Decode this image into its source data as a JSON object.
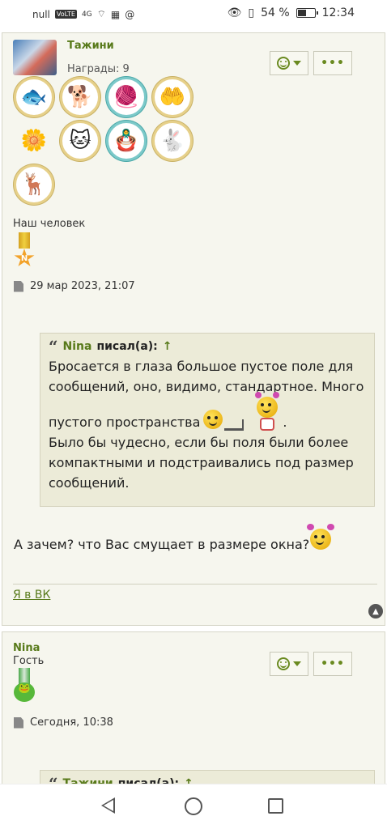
{
  "status_bar": {
    "carrier": "null",
    "network_tag": "VoLTE",
    "signal": "4G",
    "battery_percent_text": "54 %",
    "battery_level": 54,
    "time": "12:34"
  },
  "post1": {
    "username": "Тажини",
    "awards_label": "Награды: 9",
    "badges": [
      "fish-badge",
      "scottie-dog-badge",
      "yarn-ball-badge",
      "hands-badge",
      "flower-smiley-badge",
      "kitten-badge",
      "matryoshka-badge",
      "rabbit-badge",
      "deer-badge"
    ],
    "rank": "Наш человек",
    "medal_letter": "N",
    "date": "29 мар 2023, 21:07",
    "quote": {
      "author": "Nina",
      "said_suffix": "писал(а):",
      "arrow": "↑",
      "line1": "Бросается в глаза большое пустое поле для сообщений, оно, видимо, стандартное. Много",
      "line2": "пустого пространства",
      "line2_tail": ".",
      "line3": "Было бы чудесно, если бы поля были более компактными и подстраивались под размер сообщений."
    },
    "reply": "А зачем? что Вас смущает в размере окна?",
    "signature_link": "Я в ВК"
  },
  "post2": {
    "username": "Nina",
    "rank": "Гость",
    "date": "Сегодня, 10:38",
    "quote_preview": {
      "author": "Тажини",
      "said_suffix": "писал(а):",
      "arrow": "↑"
    }
  },
  "icons": {
    "reaction": "smiley-icon",
    "more": "ellipsis-icon",
    "document": "document-icon",
    "quote": "quote-icon",
    "scroll_top": "arrow-up-circle-icon"
  },
  "colors": {
    "accent_green": "#587a1a",
    "post_bg": "#f6f6ee",
    "quote_bg": "#ecebd8"
  }
}
